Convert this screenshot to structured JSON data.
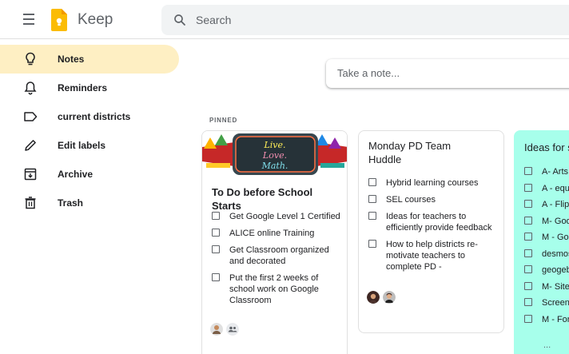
{
  "header": {
    "app_title": "Keep",
    "search_placeholder": "Search"
  },
  "colors": {
    "active_nav": "#feefc3",
    "teal_note": "#a7ffeb",
    "logo_yellow": "#fbbc04"
  },
  "sidebar": {
    "items": [
      {
        "label": "Notes",
        "icon": "lightbulb-icon",
        "active": true
      },
      {
        "label": "Reminders",
        "icon": "bell-icon",
        "active": false
      },
      {
        "label": "current districts",
        "icon": "label-icon",
        "active": false
      },
      {
        "label": "Edit labels",
        "icon": "pencil-icon",
        "active": false
      },
      {
        "label": "Archive",
        "icon": "archive-icon",
        "active": false
      },
      {
        "label": "Trash",
        "icon": "trash-icon",
        "active": false
      }
    ]
  },
  "main": {
    "take_note_placeholder": "Take a note...",
    "pinned_label": "PINNED",
    "notes": [
      {
        "banner_text": [
          "Live.",
          "Love.",
          "Math."
        ],
        "title": "To Do before School Starts",
        "items": [
          "Get Google Level 1 Certified",
          "ALICE online Training",
          "Get Classroom organized and decorated",
          "Put the first 2 weeks of school work on Google Classroom"
        ]
      },
      {
        "title": "Monday PD Team Huddle",
        "items": [
          "Hybrid learning courses",
          "SEL courses",
          "Ideas for teachers to efficiently provide feedback",
          "How to help districts re-motivate teachers to complete PD -"
        ]
      },
      {
        "title": "Ideas for s",
        "items": [
          "A- Arts",
          "A - equ",
          "A - Flip",
          "M- Goo",
          "M - Goo",
          "desmos",
          "geogeb",
          "M- Site",
          "Screenc",
          "M - For"
        ],
        "more": "..."
      }
    ]
  }
}
